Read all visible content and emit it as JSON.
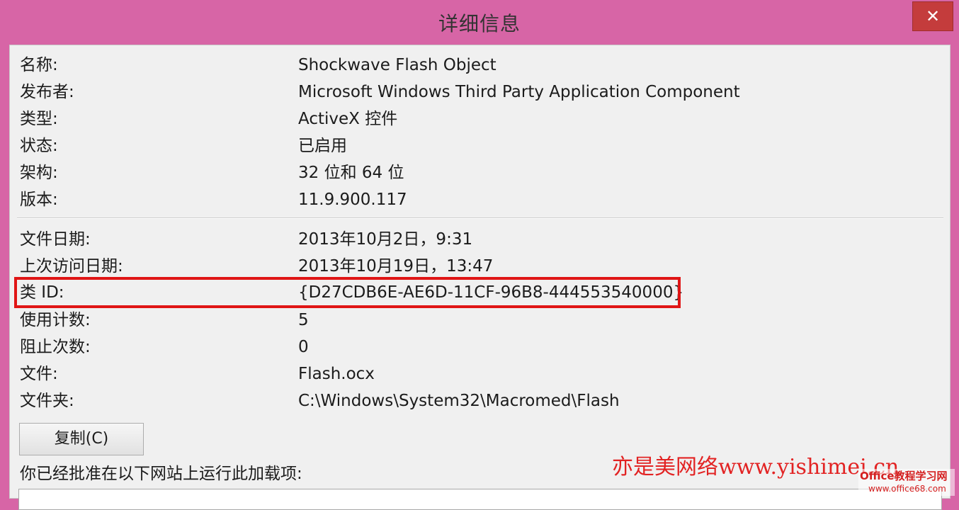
{
  "window": {
    "title": "详细信息",
    "close_icon": "✕",
    "accent_color": "#d765a6",
    "close_color": "#c43c3c"
  },
  "details_group1": [
    {
      "label": "名称:",
      "value": "Shockwave Flash Object"
    },
    {
      "label": "发布者:",
      "value": "Microsoft Windows Third Party Application Component"
    },
    {
      "label": "类型:",
      "value": "ActiveX 控件"
    },
    {
      "label": "状态:",
      "value": "已启用"
    },
    {
      "label": "架构:",
      "value": "32 位和 64 位"
    },
    {
      "label": "版本:",
      "value": "11.9.900.117"
    }
  ],
  "details_group2": [
    {
      "label": "文件日期:",
      "value": "2013年10月2日，9:31"
    },
    {
      "label": "上次访问日期:",
      "value": "2013年10月19日，13:47"
    },
    {
      "label": "类 ID:",
      "value": "{D27CDB6E-AE6D-11CF-96B8-444553540000}"
    },
    {
      "label": "使用计数:",
      "value": "5"
    },
    {
      "label": "阻止次数:",
      "value": "0"
    },
    {
      "label": "文件:",
      "value": "Flash.ocx"
    },
    {
      "label": "文件夹:",
      "value": "C:\\Windows\\System32\\Macromed\\Flash"
    }
  ],
  "copy_button_label": "复制(C)",
  "approved_sites_label": "你已经批准在以下网站上运行此加载项:",
  "watermark": {
    "text": "亦是美网络www.yishimei.cn",
    "color": "#e22323"
  },
  "logo": {
    "line1": "Office教程学习网",
    "line2": "www.office68.com"
  }
}
